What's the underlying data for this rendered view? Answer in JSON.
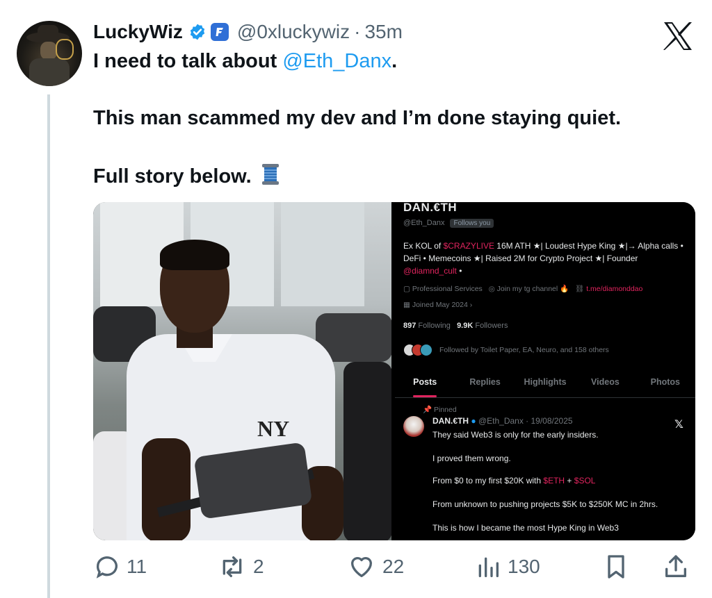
{
  "author": {
    "display_name": "LuckyWiz",
    "handle": "@0xluckywiz",
    "separator": "·",
    "time": "35m"
  },
  "tweet": {
    "line1_prefix": "I need to talk about ",
    "line1_mention": "@Eth_Danx",
    "line1_suffix": ".",
    "line2": "This man scammed my dev and I’m done staying quiet.",
    "line3": "Full story below."
  },
  "embedded_profile": {
    "name": "DAN.€TH",
    "handle": "@Eth_Danx",
    "follows_you": "Follows you",
    "bio_1": "Ex KOL of ",
    "bio_tag": "$CRAZYLIVE",
    "bio_2": " 16M ATH ★| Loudest Hype King ★|→ Alpha calls • DeFi • Memecoins ★| Raised 2M for Crypto Project ★| Founder ",
    "bio_mention": "@diamnd_cult",
    "bio_3": " •",
    "category": "Professional Services",
    "location": "Join my tg channel",
    "link": "t.me/diamonddao",
    "joined": "Joined May 2024",
    "following_count": "897",
    "following_label": "Following",
    "followers_count": "9.9K",
    "followers_label": "Followers",
    "followed_by": "Followed by Toilet Paper, EA, Neuro, and 158 others",
    "tabs": [
      "Posts",
      "Replies",
      "Highlights",
      "Videos",
      "Photos"
    ],
    "pinned_label": "Pinned",
    "post_name": "DAN.€TH",
    "post_meta": "@Eth_Danx · 19/08/2025",
    "post_line1": "They said Web3 is only for the early insiders.",
    "post_line2": "I proved them wrong.",
    "post_line3_prefix": "From $0 to my first $20K with ",
    "post_line3_eth": "$ETH",
    "post_line3_plus": " + ",
    "post_line3_sol": "$SOL",
    "post_line4": "From unknown to pushing projects $5K to $250K MC in 2hrs.",
    "post_line5": "This is how I became the most Hype King in Web3"
  },
  "photo": {
    "cap_logo": "NY"
  },
  "actions": {
    "replies": "11",
    "reposts": "2",
    "likes": "22",
    "views": "130"
  },
  "colors": {
    "link_blue": "#1d9bf0",
    "verified_blue": "#1d9bf0",
    "muted_gray": "#536471",
    "accent_pink": "#e0245e"
  }
}
